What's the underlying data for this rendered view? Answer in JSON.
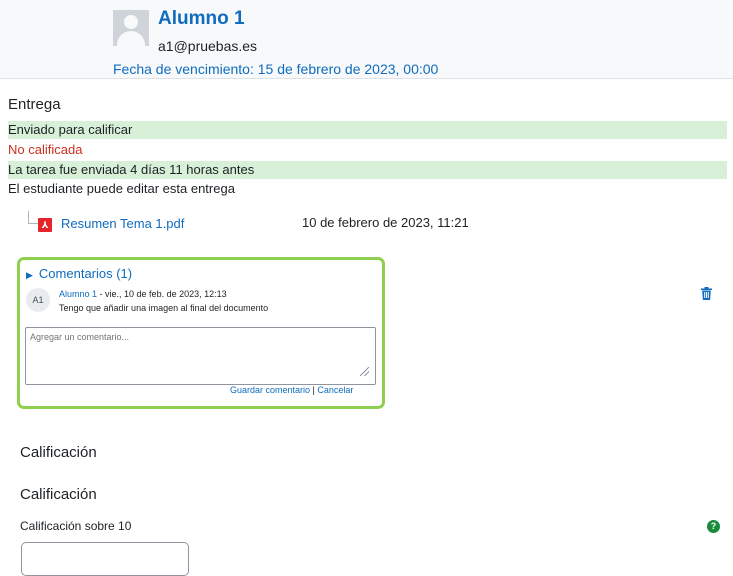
{
  "header": {
    "student_name": "Alumno 1",
    "student_email": "a1@pruebas.es",
    "due_date": "Fecha de vencimiento: 15 de febrero de 2023, 00:00"
  },
  "submission": {
    "title": "Entrega",
    "status": "Enviado para calificar",
    "grading_status": "No calificada",
    "timing": "La tarea fue enviada 4 días 11 horas antes",
    "editing": "El estudiante puede editar esta entrega",
    "file": {
      "name": "Resumen Tema 1.pdf",
      "date": "10 de febrero de 2023, 11:21"
    }
  },
  "comments": {
    "toggle_label": "Comentarios (1)",
    "items": [
      {
        "initials": "A1",
        "author": "Alumno 1",
        "date": " - vie., 10 de feb. de 2023, 12:13",
        "text": "Tengo que añadir una imagen al final del documento"
      }
    ],
    "placeholder": "Agregar un comentario...",
    "save_label": "Guardar comentario",
    "separator": " | ",
    "cancel_label": "Cancelar"
  },
  "grade": {
    "section_title": "Calificación",
    "subsection_title": "Calificación",
    "label": "Calificación sobre 10",
    "help_icon": "question-circle-icon"
  },
  "colors": {
    "link": "#0f6cbf",
    "status_green_bg": "#d7f0d7",
    "not_graded_red": "#ca3120",
    "highlight_border": "#8fcf4f"
  }
}
